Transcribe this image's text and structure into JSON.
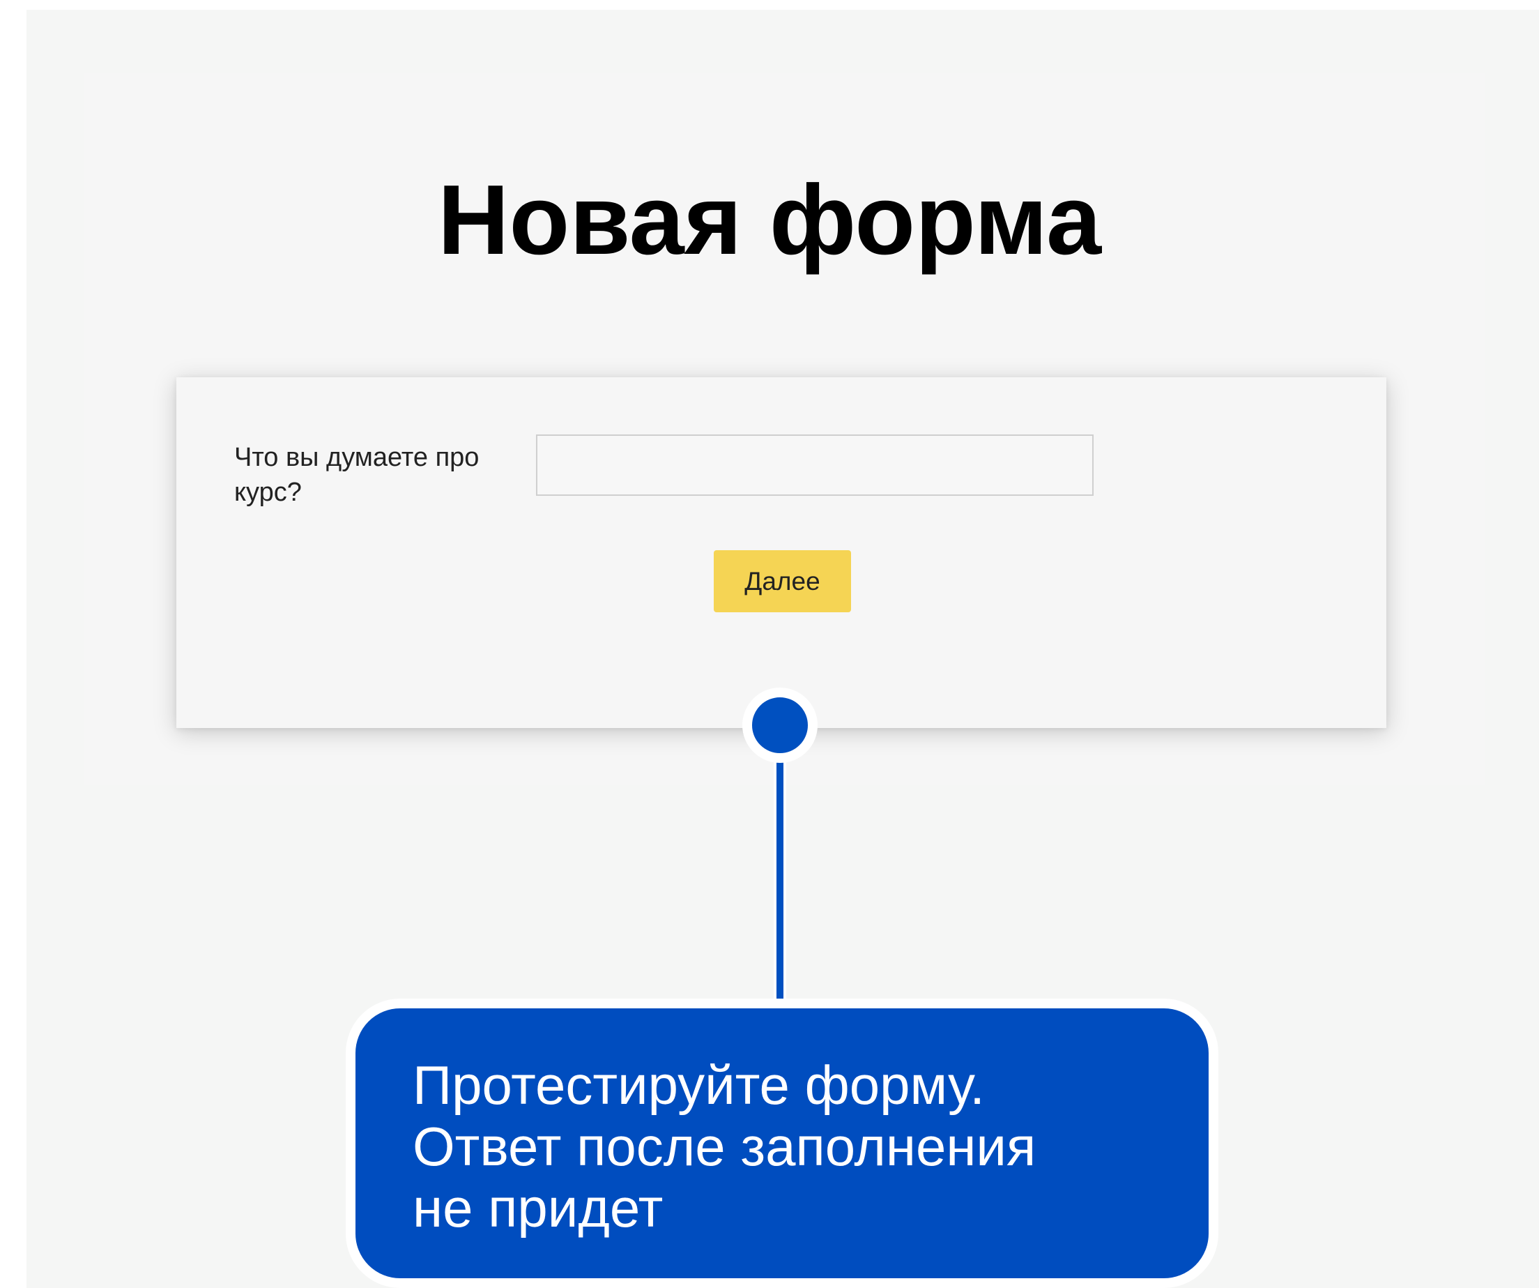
{
  "page": {
    "title": "Новая форма"
  },
  "form": {
    "question_label": "Что вы думаете про курс?",
    "answer_value": "",
    "answer_placeholder": "",
    "next_button_label": "Далее"
  },
  "callout": {
    "lines": [
      "Протестируйте форму.",
      "Ответ после заполнения",
      "не придет"
    ]
  },
  "colors": {
    "button_yellow": "#f5d454",
    "callout_blue": "#004dbf",
    "page_background": "#f5f6f5"
  }
}
